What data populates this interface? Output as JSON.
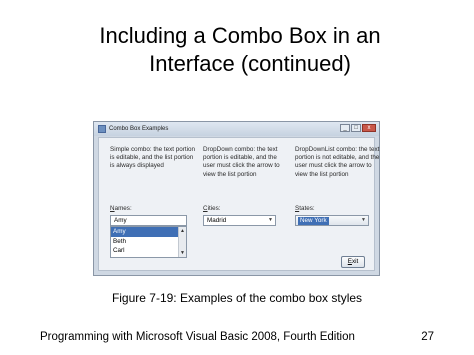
{
  "slide": {
    "title_line1": "Including a Combo Box in an",
    "title_line2": "Interface (continued)",
    "caption": "Figure 7-19: Examples of the combo box styles",
    "footer_left": "Programming with Microsoft Visual Basic 2008, Fourth Edition",
    "page_number": "27"
  },
  "window": {
    "title": "Combo Box Examples",
    "controls": {
      "minimize": "_",
      "maximize": "□",
      "close": "x"
    },
    "simple": {
      "description": "Simple combo: the text portion is editable, and the list portion is always displayed",
      "label_access": "N",
      "label_rest": "ames:",
      "text_value": "Amy",
      "items": [
        "Amy",
        "Beth",
        "Carl"
      ],
      "selected_index": 0
    },
    "dropdown": {
      "description": "DropDown combo: the text portion is editable, and the user must click the arrow to view the list portion",
      "label_access": "C",
      "label_rest": "ities:",
      "value": "Madrid"
    },
    "dropdownlist": {
      "description": "DropDownList combo: the text portion is not editable, and the user must click the arrow to view the list portion",
      "label_access": "S",
      "label_rest": "tates:",
      "value": "New York"
    },
    "exit_access": "E",
    "exit_rest": "xit"
  }
}
